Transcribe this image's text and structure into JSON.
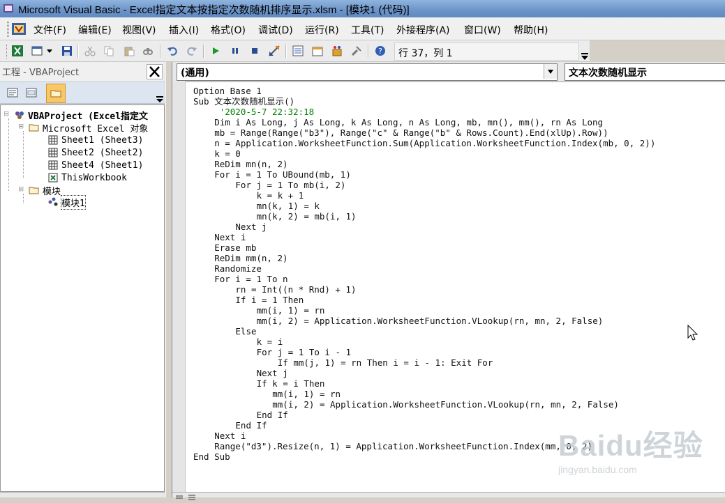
{
  "window": {
    "title": "Microsoft Visual Basic - Excel指定文本按指定次数随机排序显示.xlsm - [模块1 (代码)]"
  },
  "menu": {
    "items": [
      "文件(F)",
      "编辑(E)",
      "视图(V)",
      "插入(I)",
      "格式(O)",
      "调试(D)",
      "运行(R)",
      "工具(T)",
      "外接程序(A)",
      "窗口(W)",
      "帮助(H)"
    ]
  },
  "toolbar": {
    "position_text": "行 37，列 1",
    "buttons": [
      "excel-view-icon",
      "insert-module-icon",
      "save-icon",
      "cut-icon",
      "copy-icon",
      "paste-icon",
      "find-icon",
      "undo-icon",
      "redo-icon",
      "run-icon",
      "break-icon",
      "reset-icon",
      "design-mode-icon",
      "project-explorer-icon",
      "properties-icon",
      "object-browser-icon",
      "toolbox-icon",
      "help-icon"
    ]
  },
  "project": {
    "title": "工程 - VBAProject",
    "tree": {
      "root": "VBAProject (Excel指定文",
      "excel_objects": "Microsoft Excel 对象",
      "sheets": [
        "Sheet1 (Sheet3)",
        "Sheet2 (Sheet2)",
        "Sheet4 (Sheet1)",
        "ThisWorkbook"
      ],
      "modules_folder": "模块",
      "module": "模块1"
    }
  },
  "code": {
    "object_combo": "(通用)",
    "proc_combo": "文本次数随机显示",
    "lines": [
      {
        "indent": 0,
        "text": "Option Base 1",
        "comment": false
      },
      {
        "indent": 0,
        "text": "Sub 文本次数随机显示()",
        "comment": false
      },
      {
        "indent": 4,
        "text": " '2020-5-7 22:32:18",
        "comment": true
      },
      {
        "indent": 4,
        "text": "Dim i As Long, j As Long, k As Long, n As Long, mb, mn(), mm(), rn As Long",
        "comment": false
      },
      {
        "indent": 4,
        "text": "mb = Range(Range(\"b3\"), Range(\"c\" & Range(\"b\" & Rows.Count).End(xlUp).Row))",
        "comment": false
      },
      {
        "indent": 4,
        "text": "n = Application.WorksheetFunction.Sum(Application.WorksheetFunction.Index(mb, 0, 2))",
        "comment": false
      },
      {
        "indent": 4,
        "text": "k = 0",
        "comment": false
      },
      {
        "indent": 4,
        "text": "ReDim mn(n, 2)",
        "comment": false
      },
      {
        "indent": 4,
        "text": "For i = 1 To UBound(mb, 1)",
        "comment": false
      },
      {
        "indent": 8,
        "text": "For j = 1 To mb(i, 2)",
        "comment": false
      },
      {
        "indent": 12,
        "text": "k = k + 1",
        "comment": false
      },
      {
        "indent": 12,
        "text": "mn(k, 1) = k",
        "comment": false
      },
      {
        "indent": 12,
        "text": "mn(k, 2) = mb(i, 1)",
        "comment": false
      },
      {
        "indent": 8,
        "text": "Next j",
        "comment": false
      },
      {
        "indent": 4,
        "text": "Next i",
        "comment": false
      },
      {
        "indent": 4,
        "text": "Erase mb",
        "comment": false
      },
      {
        "indent": 4,
        "text": "ReDim mm(n, 2)",
        "comment": false
      },
      {
        "indent": 4,
        "text": "Randomize",
        "comment": false
      },
      {
        "indent": 4,
        "text": "For i = 1 To n",
        "comment": false
      },
      {
        "indent": 8,
        "text": "rn = Int((n * Rnd) + 1)",
        "comment": false
      },
      {
        "indent": 8,
        "text": "If i = 1 Then",
        "comment": false
      },
      {
        "indent": 12,
        "text": "mm(i, 1) = rn",
        "comment": false
      },
      {
        "indent": 12,
        "text": "mm(i, 2) = Application.WorksheetFunction.VLookup(rn, mn, 2, False)",
        "comment": false
      },
      {
        "indent": 8,
        "text": "Else",
        "comment": false
      },
      {
        "indent": 12,
        "text": "k = i",
        "comment": false
      },
      {
        "indent": 12,
        "text": "For j = 1 To i - 1",
        "comment": false
      },
      {
        "indent": 16,
        "text": "If mm(j, 1) = rn Then i = i - 1: Exit For",
        "comment": false
      },
      {
        "indent": 12,
        "text": "Next j",
        "comment": false
      },
      {
        "indent": 12,
        "text": "If k = i Then",
        "comment": false
      },
      {
        "indent": 15,
        "text": "mm(i, 1) = rn",
        "comment": false
      },
      {
        "indent": 15,
        "text": "mm(i, 2) = Application.WorksheetFunction.VLookup(rn, mn, 2, False)",
        "comment": false
      },
      {
        "indent": 12,
        "text": "End If",
        "comment": false
      },
      {
        "indent": 8,
        "text": "End If",
        "comment": false
      },
      {
        "indent": 4,
        "text": "Next i",
        "comment": false
      },
      {
        "indent": 4,
        "text": "Range(\"d3\").Resize(n, 1) = Application.WorksheetFunction.Index(mm, 0, 2)",
        "comment": false
      },
      {
        "indent": 0,
        "text": "End Sub",
        "comment": false
      }
    ]
  },
  "watermark": {
    "brand": "Baidu经验",
    "url": "jingyan.baidu.com"
  }
}
